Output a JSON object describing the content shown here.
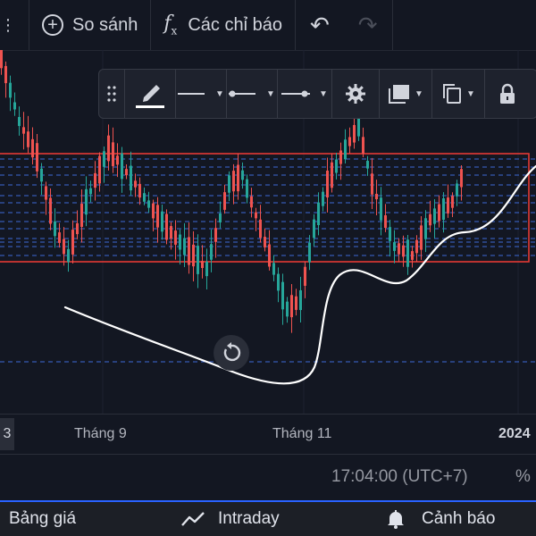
{
  "topbar": {
    "compare_label": "So sánh",
    "indicators_label": "Các chỉ báo",
    "fx_glyph": "f",
    "fx_sub": "x"
  },
  "drawing_toolbar": {
    "tools": [
      "drag-handle",
      "pencil",
      "line-style",
      "line-end-style",
      "line-point-style",
      "settings",
      "fill",
      "clone",
      "lock"
    ],
    "accent_color": "#ffffff"
  },
  "chart": {
    "up_color": "#26a69a",
    "down_color": "#ef5350",
    "rect_color": "#e53935",
    "dash_color": "#3d6ad6",
    "curve_color": "#ffffff"
  },
  "time_axis": {
    "left_clip": "3",
    "labels": [
      "Tháng 9",
      "Tháng 11",
      "2024"
    ]
  },
  "status": {
    "time": "17:04:00 (UTC+7)",
    "percent": "%"
  },
  "bottom_nav": {
    "price_board": "Bảng giá",
    "intraday": "Intraday",
    "alerts": "Cảnh báo"
  }
}
